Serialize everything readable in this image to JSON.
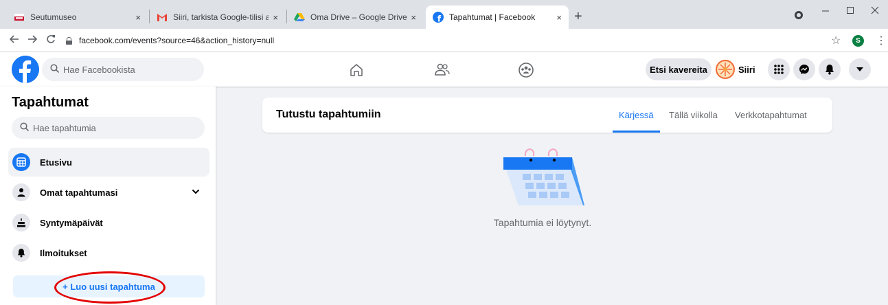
{
  "browser": {
    "tabs": [
      {
        "title": "Seutumuseo",
        "active": false
      },
      {
        "title": "Siiri, tarkista Google-tilisi asetukset",
        "active": false
      },
      {
        "title": "Oma Drive – Google Drive",
        "active": false
      },
      {
        "title": "Tapahtumat | Facebook",
        "active": true
      }
    ],
    "new_tab": "+",
    "close_glyph": "×",
    "url": "facebook.com/events?source=46&action_history=null",
    "profile_initial": "S"
  },
  "fb": {
    "search_placeholder": "Hae Facebookista",
    "find_friends_label": "Etsi kavereita",
    "profile_name": "Siiri",
    "brand_color": "#1877f2"
  },
  "sidebar": {
    "title": "Tapahtumat",
    "search_placeholder": "Hae tapahtumia",
    "items": [
      {
        "label": "Etusivu",
        "icon": "calendar-grid-icon",
        "active": true
      },
      {
        "label": "Omat tapahtumasi",
        "icon": "person-icon",
        "active": false
      },
      {
        "label": "Syntymäpäivät",
        "icon": "cake-icon",
        "active": false
      },
      {
        "label": "Ilmoitukset",
        "icon": "bell-icon",
        "active": false
      }
    ],
    "create_label": "+ Luo uusi tapahtuma"
  },
  "main": {
    "title": "Tutustu tapahtumiin",
    "tabs": [
      {
        "label": "Kärjessä",
        "active": true
      },
      {
        "label": "Tällä viikolla",
        "active": false
      },
      {
        "label": "Verkkotapahtumat",
        "active": false
      }
    ],
    "empty_message": "Tapahtumia ei löytynyt."
  }
}
